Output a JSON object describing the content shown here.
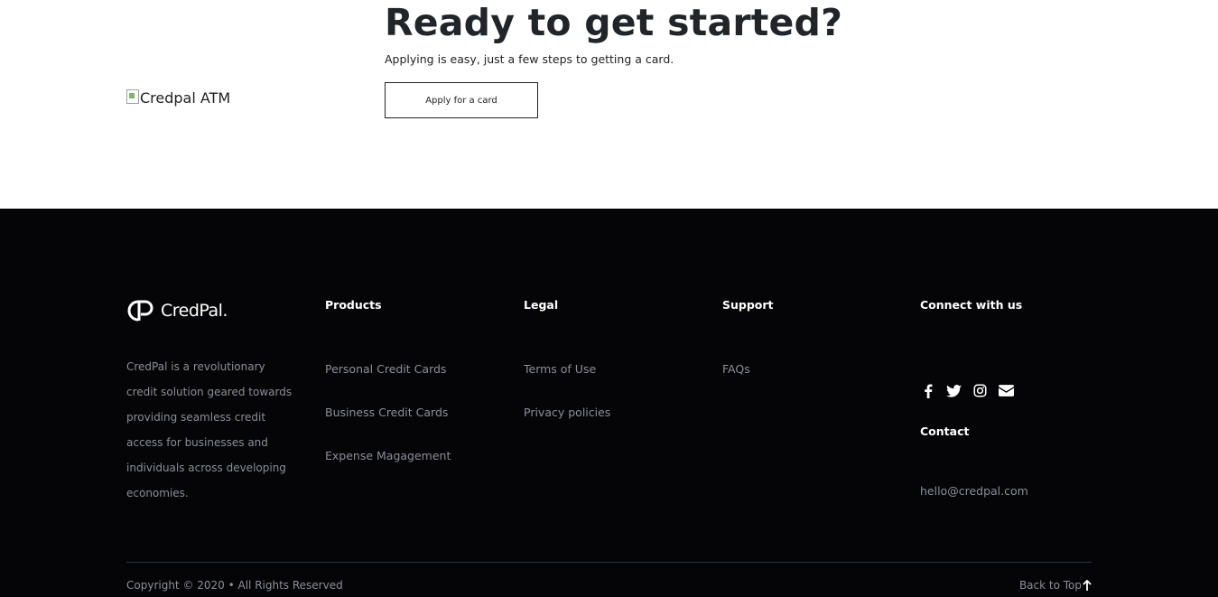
{
  "cta": {
    "image_alt": "Credpal ATM",
    "title": "Ready to get started?",
    "subtitle": "Applying is easy, just a few steps to getting a card.",
    "button_label": "Apply for a card"
  },
  "footer": {
    "logo_text": "CredPal.",
    "description": "CredPal is a revolutionary credit solution geared towards providing seamless credit access for businesses and individuals across developing economies.",
    "columns": [
      {
        "heading": "Products",
        "links": [
          "Personal Credit Cards",
          "Business Credit Cards",
          "Expense Magagement"
        ]
      },
      {
        "heading": "Legal",
        "links": [
          "Terms of Use",
          "Privacy policies"
        ]
      },
      {
        "heading": "Support",
        "links": [
          "FAQs"
        ]
      }
    ],
    "connect_heading": "Connect with us",
    "social_icons": [
      "facebook-icon",
      "twitter-icon",
      "instagram-icon",
      "envelope-icon"
    ],
    "contact_heading": "Contact",
    "contact_email": "hello@credpal.com",
    "copyright": "Copyright © 2020 • All Rights Reserved",
    "back_to_top": "Back to Top"
  },
  "colors": {
    "footer_bg": "#050507",
    "muted_text": "#8c8f97",
    "divider": "#2d3246",
    "heading_text": "#212529"
  }
}
